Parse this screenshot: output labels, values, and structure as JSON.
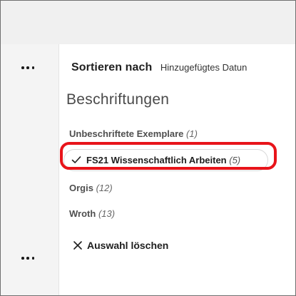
{
  "sort": {
    "label": "Sortieren nach",
    "value": "Hinzugefügtes Datun"
  },
  "labels_section": {
    "title": "Beschriftungen",
    "items": [
      {
        "name": "Unbeschriftete Exemplare",
        "count": "(1)",
        "selected": false
      },
      {
        "name": "FS21 Wissenschaftlich Arbeiten",
        "count": "(5)",
        "selected": true
      },
      {
        "name": "Orgis",
        "count": "(12)",
        "selected": false
      },
      {
        "name": "Wroth",
        "count": "(13)",
        "selected": false
      }
    ]
  },
  "clear_selection": {
    "label": "Auswahl löschen"
  },
  "icons": {
    "more": "more-horizontal-icon",
    "check": "checkmark-icon",
    "clear": "close-x-icon"
  },
  "colors": {
    "highlight": "#e8141a",
    "topbar": "#f0f0f0",
    "sidebar": "#f4f4f4"
  }
}
